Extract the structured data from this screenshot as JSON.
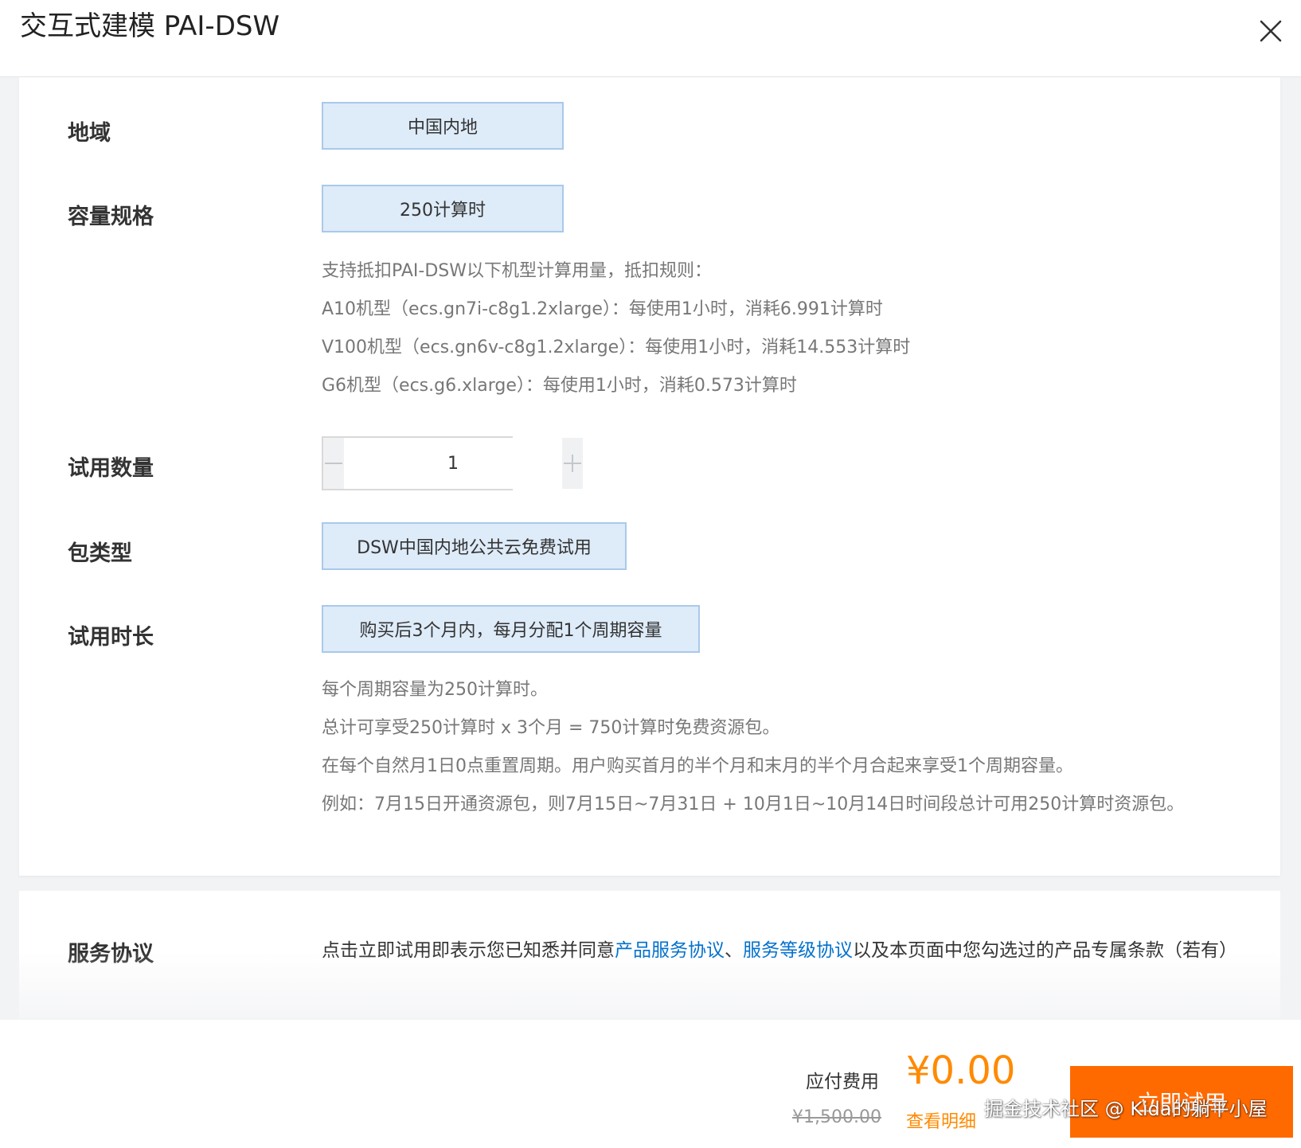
{
  "header": {
    "title": "交互式建模 PAI-DSW",
    "close_icon": "close-icon"
  },
  "config": {
    "region": {
      "label": "地域",
      "value": "中国内地"
    },
    "capacity": {
      "label": "容量规格",
      "value": "250计算时",
      "notes": [
        "支持抵扣PAI-DSW以下机型计算用量，抵扣规则：",
        "A10机型（ecs.gn7i-c8g1.2xlarge）：每使用1小时，消耗6.991计算时",
        "V100机型（ecs.gn6v-c8g1.2xlarge）：每使用1小时，消耗14.553计算时",
        "G6机型（ecs.g6.xlarge）：每使用1小时，消耗0.573计算时"
      ]
    },
    "quantity": {
      "label": "试用数量",
      "value": "1",
      "minus_icon": "minus-icon",
      "plus_icon": "plus-icon"
    },
    "package_type": {
      "label": "包类型",
      "value": "DSW中国内地公共云免费试用"
    },
    "duration": {
      "label": "试用时长",
      "value": "购买后3个月内，每月分配1个周期容量",
      "notes": [
        "每个周期容量为250计算时。",
        "总计可享受250计算时 x 3个月 = 750计算时免费资源包。",
        "在每个自然月1日0点重置周期。用户购买首月的半个月和末月的半个月合起来享受1个周期容量。",
        "例如：7月15日开通资源包，则7月15日~7月31日 + 10月1日~10月14日时间段总计可用250计算时资源包。"
      ]
    }
  },
  "agreement": {
    "label": "服务协议",
    "text_before": "点击立即试用即表示您已知悉并同意",
    "link1": "产品服务协议",
    "separator": "、",
    "link2": "服务等级协议",
    "text_after": "以及本页面中您勾选过的产品专属条款（若有）"
  },
  "footer": {
    "fee_label": "应付费用",
    "price": "¥0.00",
    "original_price": "¥1,500.00",
    "detail_link": "查看明细",
    "try_button": "立即试用"
  },
  "watermark": "掘金技术社区 @ Kida的躺平小屋",
  "colors": {
    "accent_orange": "#ff6a00",
    "price_orange": "#ff8a00",
    "link_blue": "#0070cc",
    "option_bg": "#deebf9",
    "option_border": "#a9c9ea"
  }
}
